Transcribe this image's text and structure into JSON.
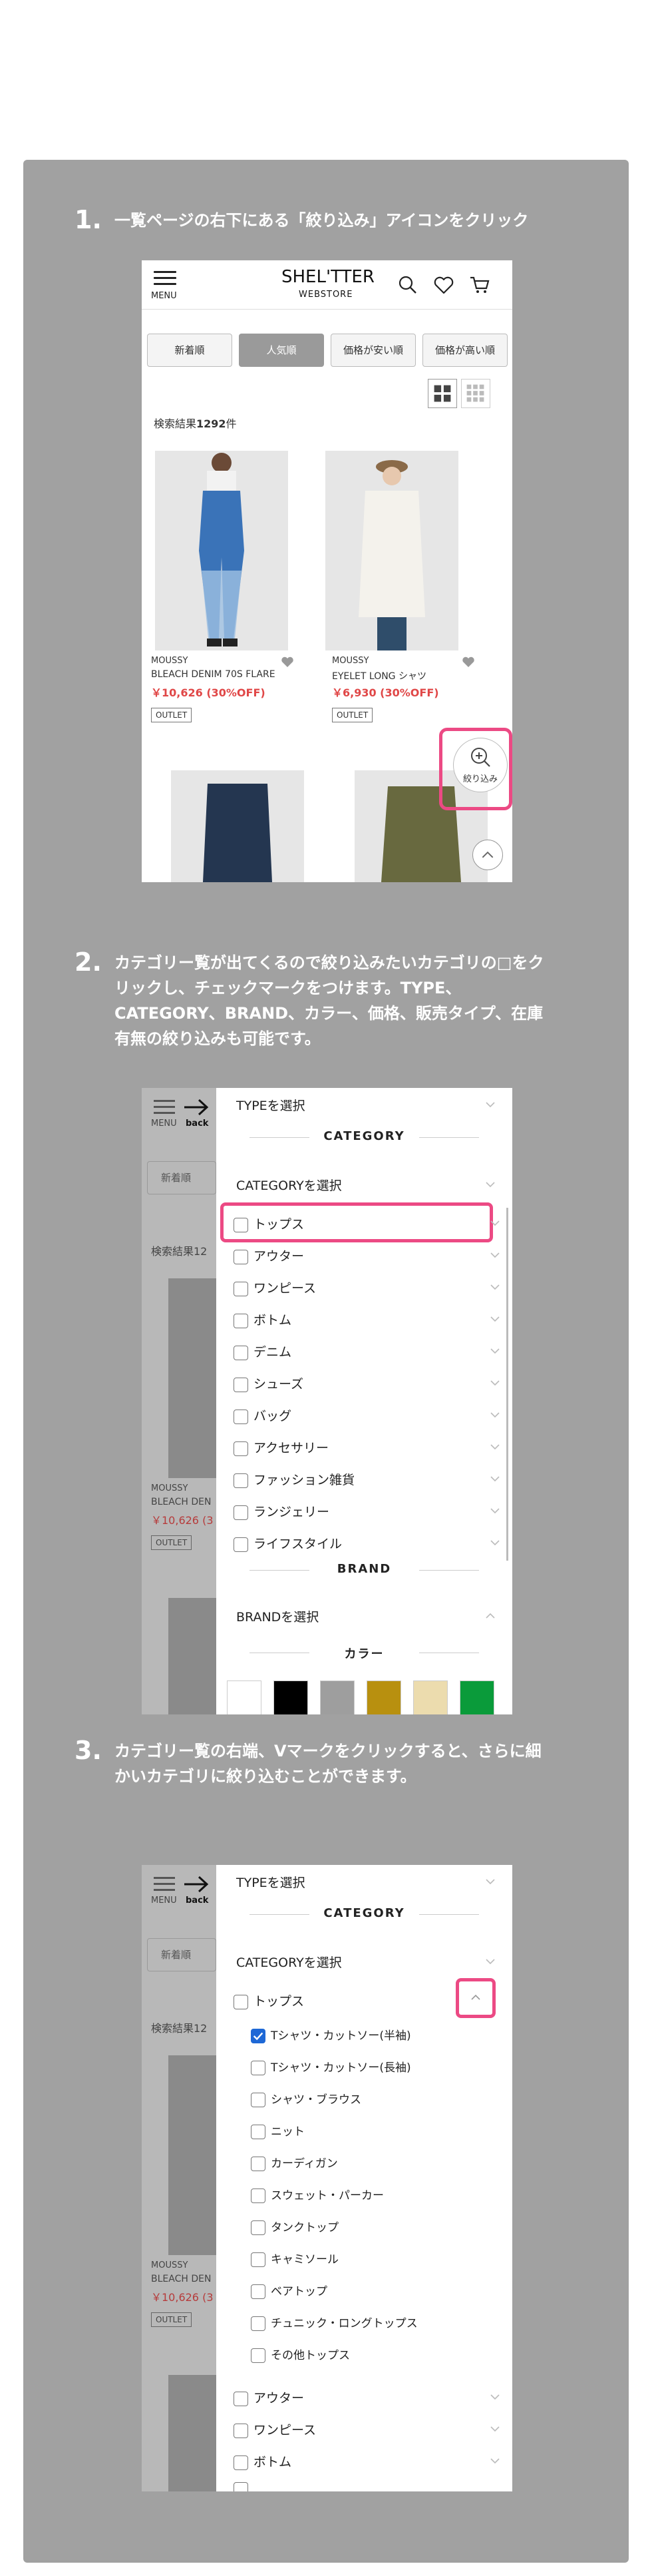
{
  "steps": [
    {
      "num": "1.",
      "text": "一覧ページの右下にある「絞り込み」アイコンをクリック"
    },
    {
      "num": "2.",
      "text": "カテゴリー覧が出てくるので絞り込みたいカテゴリの□をクリックし、チェックマークをつけます。TYPE、CATEGORY、BRAND、カラー、価格、販売タイプ、在庫有無の絞り込みも可能です。"
    },
    {
      "num": "3.",
      "text": "カテゴリー覧の右端、Vマークをクリックすると、さらに細かいカテゴリに絞り込むことができます。"
    }
  ],
  "header": {
    "menu_label": "MENU",
    "logo_main": "SHEL'TTER",
    "logo_sub": "WEBSTORE",
    "back_label": "back"
  },
  "sort_buttons": [
    "新着順",
    "人気順",
    "価格が安い順",
    "価格が高い順"
  ],
  "results": {
    "prefix": "検索結果",
    "count": "1292",
    "suffix": "件"
  },
  "products": [
    {
      "brand": "MOUSSY",
      "name": "BLEACH DENIM 70S FLARE",
      "price": "￥10,626 (30%OFF)",
      "badge": "OUTLET"
    },
    {
      "brand": "MOUSSY",
      "name": "EYELET LONG シャツ",
      "price": "￥6,930 (30%OFF)",
      "badge": "OUTLET"
    }
  ],
  "filter_button_label": "絞り込み",
  "behind": {
    "results": "検索結果12",
    "brand": "MOUSSY",
    "name": "BLEACH DEN",
    "price": "￥10,626 (3",
    "badge": "OUTLET"
  },
  "filter": {
    "type_select": "TYPEを選択",
    "category_heading": "CATEGORY",
    "category_select": "CATEGORYを選択",
    "categories": [
      "トップス",
      "アウター",
      "ワンピース",
      "ボトム",
      "デニム",
      "シューズ",
      "バッグ",
      "アクセサリー",
      "ファッション雑貨",
      "ランジェリー",
      "ライフスタイル"
    ],
    "brand_heading": "BRAND",
    "brand_select": "BRANDを選択",
    "color_heading": "カラー",
    "colors": [
      "#ffffff",
      "#000000",
      "#9e9e9e",
      "#b8900f",
      "#ecdcae",
      "#0a9b3a"
    ],
    "sub_tops": [
      "Tシャツ・カットソー(半袖)",
      "Tシャツ・カットソー(長袖)",
      "シャツ・ブラウス",
      "ニット",
      "カーディガン",
      "スウェット・パーカー",
      "タンクトップ",
      "キャミソール",
      "ベアトップ",
      "チュニック・ロングトップス",
      "その他トップス"
    ],
    "after_tops": [
      "アウター",
      "ワンピース",
      "ボトム"
    ]
  },
  "accent": "#ec4a84"
}
